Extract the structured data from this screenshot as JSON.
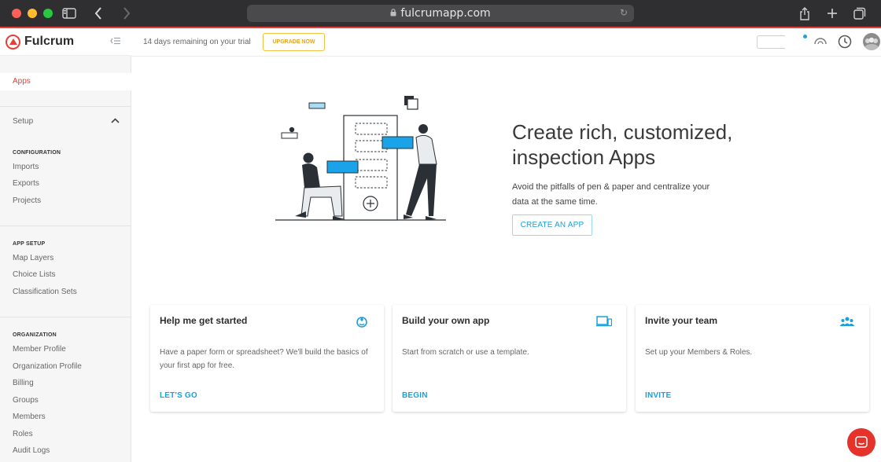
{
  "browser": {
    "url": "fulcrumapp.com",
    "colors": {
      "close": "#fe5f57",
      "minimize": "#febc2e",
      "maximize": "#28c840"
    },
    "icons": [
      "sidebar-toggle-icon",
      "back-icon",
      "forward-icon",
      "lock-icon",
      "reload-icon",
      "share-icon",
      "new-tab-icon",
      "tabs-icon"
    ]
  },
  "sidebar": {
    "brand": "Fulcrum",
    "active_item": "Apps",
    "setup_label": "Setup",
    "sections": [
      {
        "title": "CONFIGURATION",
        "items": [
          "Imports",
          "Exports",
          "Projects"
        ]
      },
      {
        "title": "APP SETUP",
        "items": [
          "Map Layers",
          "Choice Lists",
          "Classification Sets"
        ]
      },
      {
        "title": "ORGANIZATION",
        "items": [
          "Member Profile",
          "Organization Profile",
          "Billing",
          "Groups",
          "Members",
          "Roles",
          "Audit Logs"
        ]
      }
    ]
  },
  "topbar": {
    "trial_text": "14 days remaining on your trial",
    "upgrade_label": "UPGRADE NOW",
    "colors": {
      "upgrade": "#e8a21c",
      "notification_dot": "#1aa3dc"
    }
  },
  "hero": {
    "title_line1": "Create rich, customized,",
    "title_line2": "inspection Apps",
    "subtitle_line1": "Avoid the pitfalls of pen & paper and centralize your",
    "subtitle_line2": "data at the same time.",
    "cta_label": "CREATE AN APP"
  },
  "cards": [
    {
      "title": "Help me get started",
      "desc_line1": "Have a paper form or spreadsheet? We'll build the basics of",
      "desc_line2": "your first app for free.",
      "link": "LET'S GO",
      "icon": "rocket-badge-icon"
    },
    {
      "title": "Build your own app",
      "desc_line1": "Start from scratch or use a template.",
      "desc_line2": "",
      "link": "BEGIN",
      "icon": "devices-icon"
    },
    {
      "title": "Invite your team",
      "desc_line1": "Set up your Members & Roles.",
      "desc_line2": "",
      "link": "INVITE",
      "icon": "team-icon"
    }
  ],
  "theme": {
    "accent": "#1e9fd6",
    "brand_red": "#e53f37"
  }
}
